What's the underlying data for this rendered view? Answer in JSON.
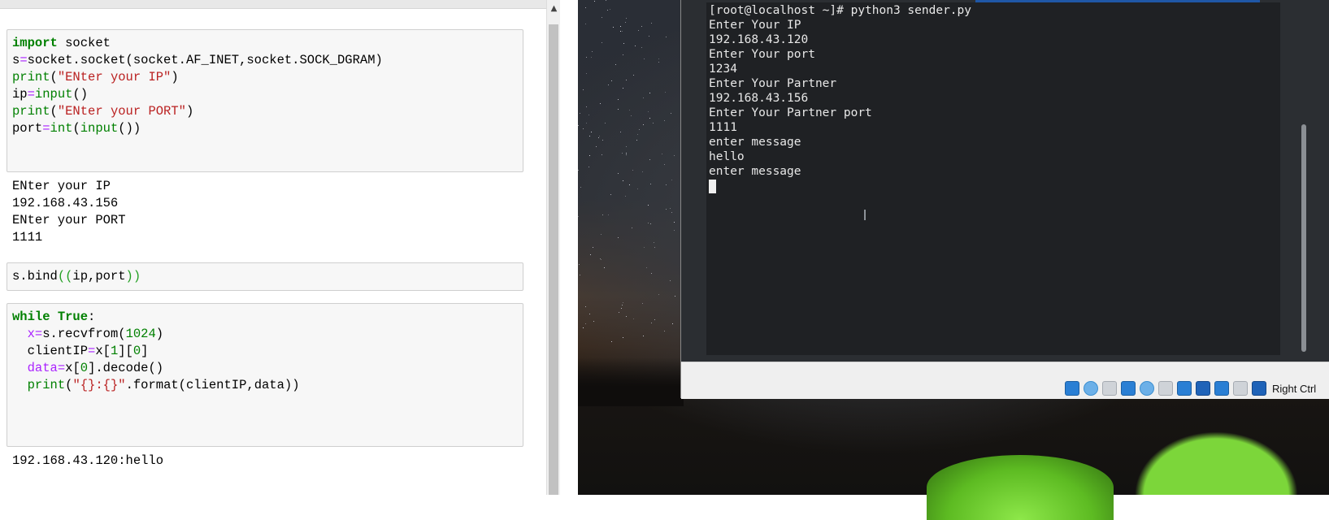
{
  "notebook": {
    "cells": [
      {
        "lines": [
          [
            [
              "kw",
              "import"
            ],
            [
              "plain",
              " socket"
            ]
          ],
          [
            [
              "plain",
              "s"
            ],
            [
              "op",
              "="
            ],
            [
              "plain",
              "socket.socket(socket.AF_INET,socket.SOCK_DGRAM)"
            ]
          ],
          [
            [
              "bi",
              "print"
            ],
            [
              "plain",
              "("
            ],
            [
              "str",
              "\"ENter your IP\""
            ],
            [
              "plain",
              ")"
            ]
          ],
          [
            [
              "plain",
              "ip"
            ],
            [
              "op",
              "="
            ],
            [
              "bi",
              "input"
            ],
            [
              "plain",
              "()"
            ]
          ],
          [
            [
              "bi",
              "print"
            ],
            [
              "plain",
              "("
            ],
            [
              "str",
              "\"ENter your PORT\""
            ],
            [
              "plain",
              ")"
            ]
          ],
          [
            [
              "plain",
              "port"
            ],
            [
              "op",
              "="
            ],
            [
              "bi",
              "int"
            ],
            [
              "plain",
              "("
            ],
            [
              "bi",
              "input"
            ],
            [
              "plain",
              "())"
            ]
          ]
        ],
        "output": [
          "ENter your IP",
          "192.168.43.156",
          "ENter your PORT",
          "1111"
        ]
      },
      {
        "lines": [
          [
            [
              "plain",
              "s.bind"
            ],
            [
              "par",
              "(("
            ],
            [
              "plain",
              "ip,port"
            ],
            [
              "par",
              "))"
            ]
          ]
        ],
        "output": []
      },
      {
        "lines": [
          [
            [
              "kw",
              "while"
            ],
            [
              "plain",
              " "
            ],
            [
              "kw",
              "True"
            ],
            [
              "plain",
              ":"
            ]
          ],
          [
            [
              "plain",
              "  "
            ],
            [
              "op",
              "x"
            ],
            [
              "op",
              "="
            ],
            [
              "plain",
              "s.recvfrom("
            ],
            [
              "num",
              "1024"
            ],
            [
              "plain",
              ")"
            ]
          ],
          [
            [
              "plain",
              "  clientIP"
            ],
            [
              "op",
              "="
            ],
            [
              "plain",
              "x["
            ],
            [
              "num",
              "1"
            ],
            [
              "plain",
              "]["
            ],
            [
              "num",
              "0"
            ],
            [
              "plain",
              "]"
            ]
          ],
          [
            [
              "plain",
              "  "
            ],
            [
              "op",
              "data"
            ],
            [
              "op",
              "="
            ],
            [
              "plain",
              "x["
            ],
            [
              "num",
              "0"
            ],
            [
              "plain",
              "].decode()"
            ]
          ],
          [
            [
              "plain",
              "  "
            ],
            [
              "bi",
              "print"
            ],
            [
              "plain",
              "("
            ],
            [
              "str",
              "\"{}:{}\""
            ],
            [
              "plain",
              ".format(clientIP,data))"
            ]
          ]
        ],
        "output": [
          "192.168.43.120:hello"
        ]
      }
    ]
  },
  "terminal": {
    "lines": [
      "[root@localhost ~]# python3 sender.py",
      "Enter Your IP",
      "192.168.43.120",
      "Enter Your port",
      "1234",
      "Enter Your Partner",
      "192.168.43.156",
      "Enter Your Partner port",
      "1111",
      "enter message",
      "hello",
      "enter message"
    ]
  },
  "statusbar": {
    "icons": [
      {
        "name": "audio-icon",
        "style": "blue"
      },
      {
        "name": "optical-drive-icon",
        "style": "lightblue"
      },
      {
        "name": "usb-icon",
        "style": "gray"
      },
      {
        "name": "network-icon",
        "style": "blue"
      },
      {
        "name": "shared-folders-icon",
        "style": "lightblue"
      },
      {
        "name": "display-icon",
        "style": "gray"
      },
      {
        "name": "video-capture-icon",
        "style": "blue"
      },
      {
        "name": "recording-icon",
        "style": "dblue"
      },
      {
        "name": "virtualization-icon",
        "style": "blue"
      },
      {
        "name": "mouse-integration-icon",
        "style": "gray"
      },
      {
        "name": "keyboard-capture-icon",
        "style": "dblue"
      }
    ],
    "host_key_label": "Right Ctrl"
  },
  "scroll_up_glyph": "▲",
  "ibeam_glyph": "I",
  "colors": {
    "keyword": "#008000",
    "operator": "#aa22ff",
    "string": "#ba2121",
    "terminal_bg": "#1f2124",
    "terminal_text": "#e8e8e8"
  }
}
